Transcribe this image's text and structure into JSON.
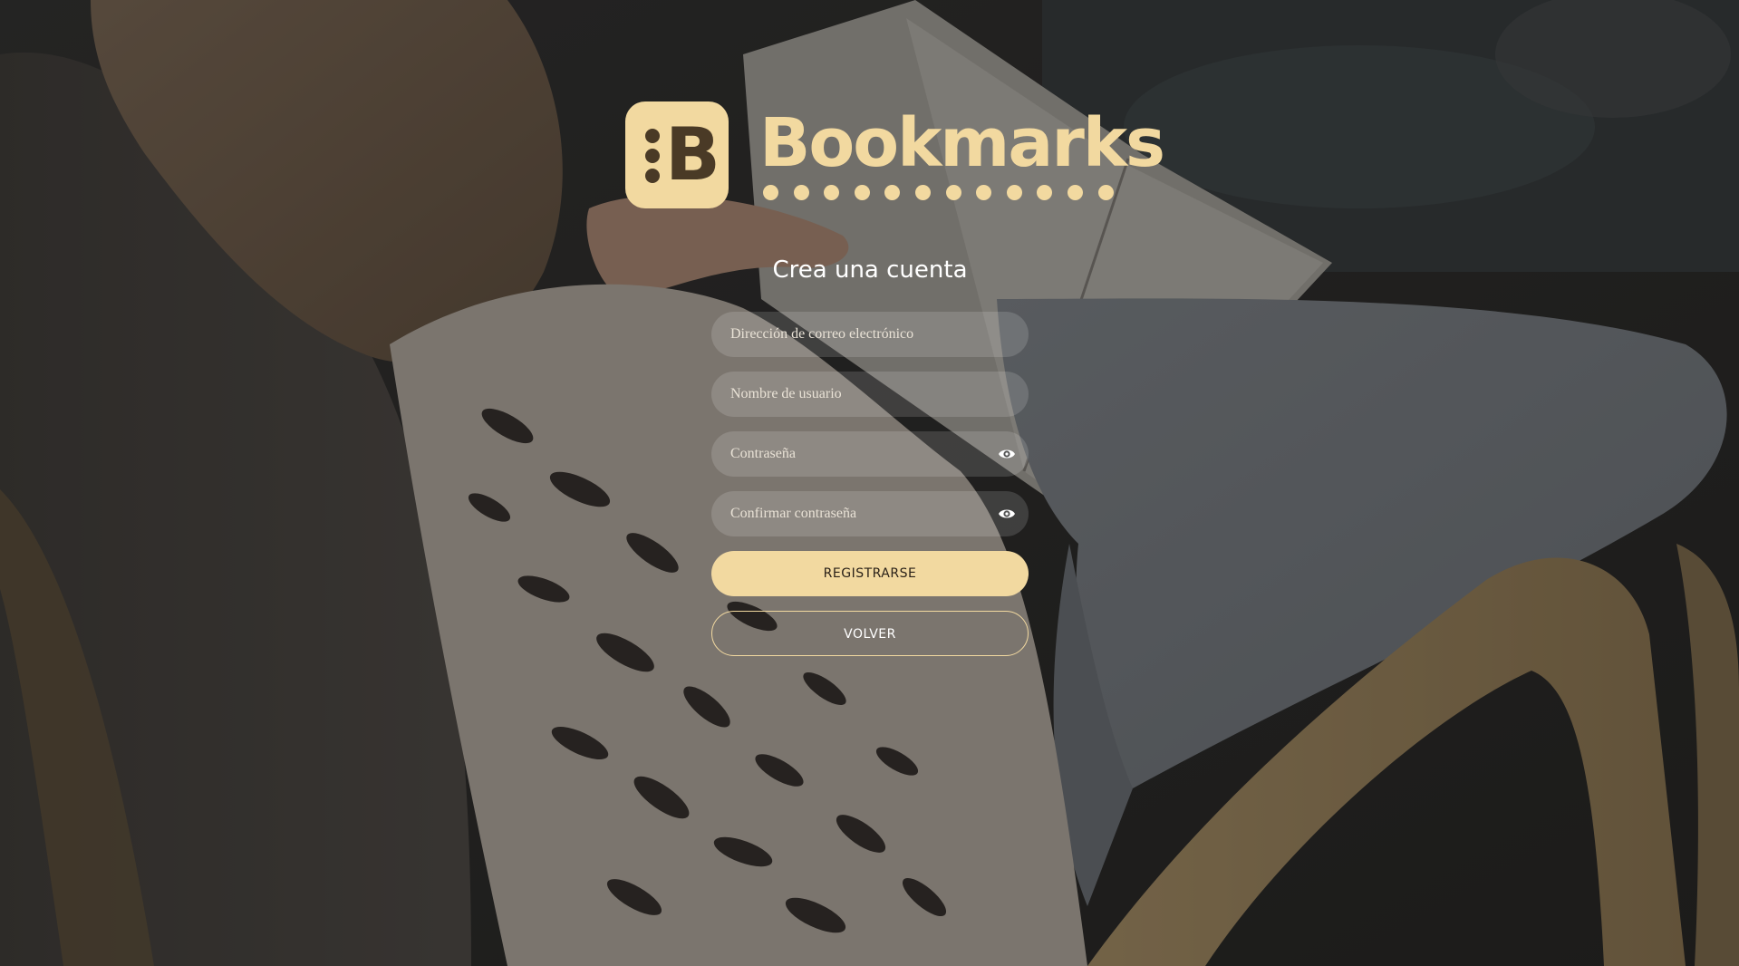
{
  "brand": {
    "name": "Bookmarks",
    "badge_letter": "B",
    "accent_color": "#f2d9a0",
    "badge_dark_color": "#4a3a26"
  },
  "form": {
    "heading": "Crea una cuenta",
    "email": {
      "placeholder": "Dirección de correo electrónico",
      "value": ""
    },
    "username": {
      "placeholder": "Nombre de usuario",
      "value": ""
    },
    "password": {
      "placeholder": "Contraseña",
      "value": "",
      "toggle_icon": "eye-icon"
    },
    "confirm_password": {
      "placeholder": "Confirmar contraseña",
      "value": "",
      "toggle_icon": "eye-icon"
    },
    "register_label": "REGISTRARSE",
    "back_label": "VOLVER"
  },
  "background": {
    "description_icon": "photo-background",
    "overlay_color": "#000000"
  }
}
